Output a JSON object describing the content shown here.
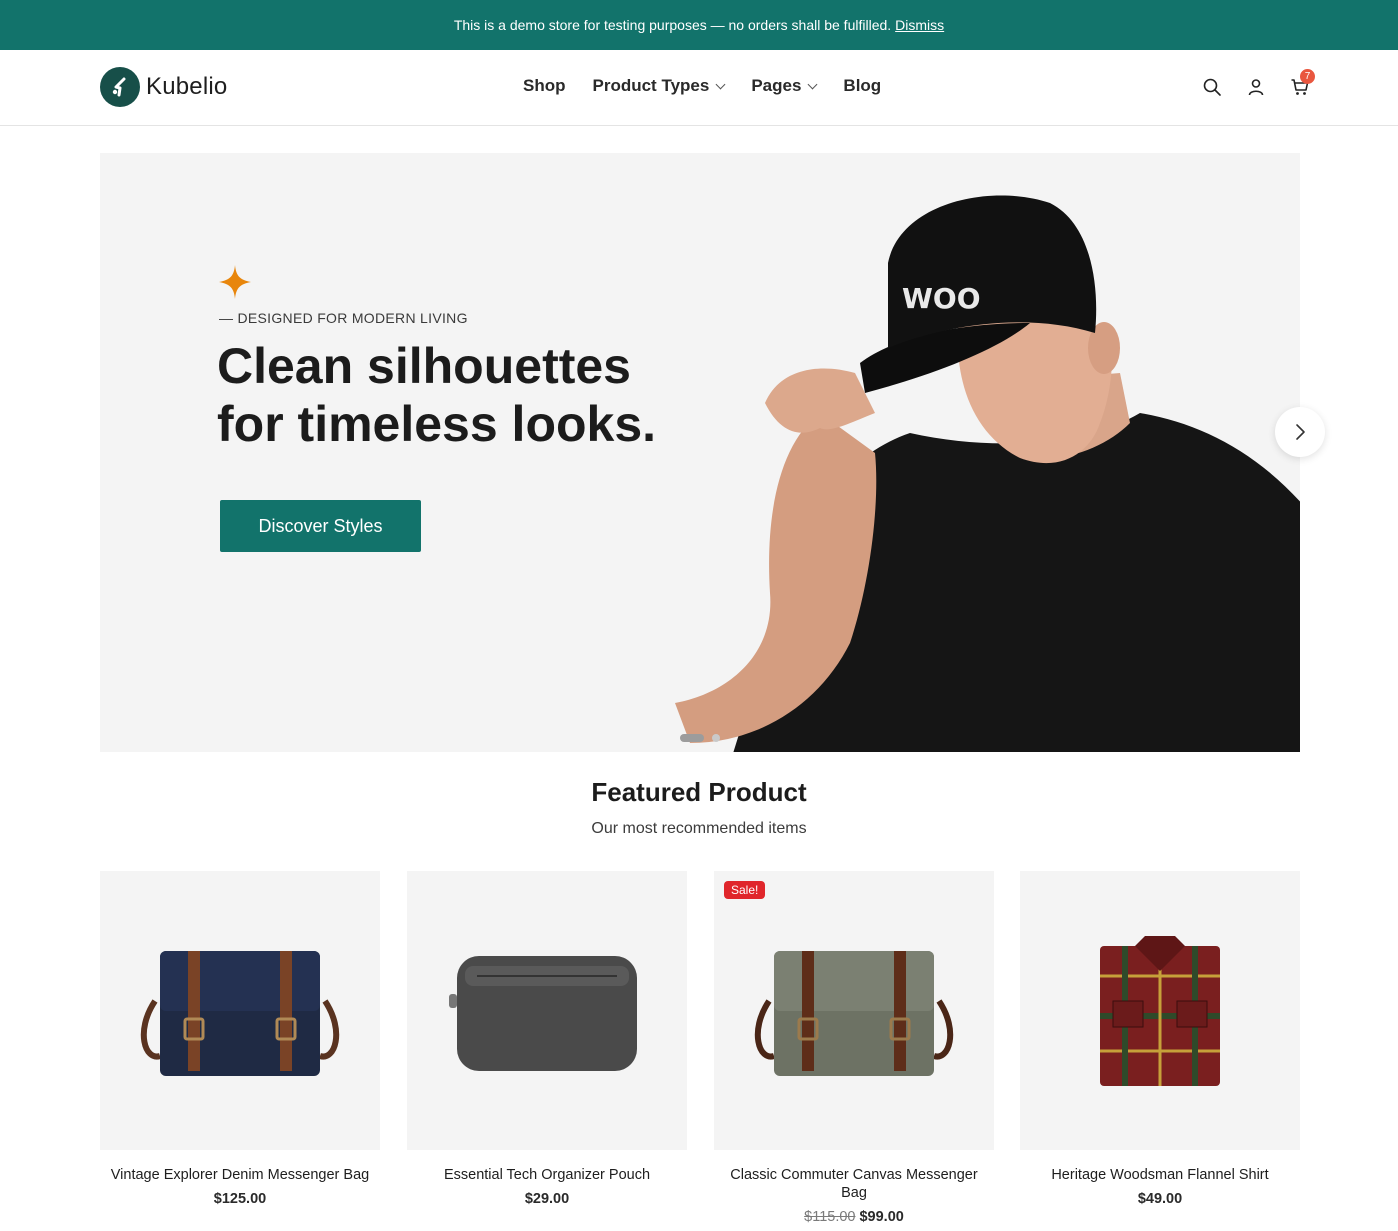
{
  "notice": {
    "text": "This is a demo store for testing purposes — no orders shall be fulfilled.",
    "dismiss": "Dismiss"
  },
  "header": {
    "brand": "Kubelio",
    "nav": [
      {
        "label": "Shop"
      },
      {
        "label": "Product Types"
      },
      {
        "label": "Pages"
      },
      {
        "label": "Blog"
      }
    ],
    "cart_count": "7"
  },
  "hero": {
    "eyebrow": "— DESIGNED FOR MODERN LIVING",
    "title_line1": "Clean silhouettes",
    "title_line2": "for timeless looks.",
    "cta": "Discover Styles",
    "cap_text": "WOO"
  },
  "featured": {
    "title": "Featured Product",
    "subtitle": "Our most recommended items",
    "products": [
      {
        "name": "Vintage Explorer Denim Messenger Bag",
        "price": "$125.00",
        "old_price": "",
        "sale": ""
      },
      {
        "name": "Essential Tech Organizer Pouch",
        "price": "$29.00",
        "old_price": "",
        "sale": ""
      },
      {
        "name": "Classic Commuter Canvas Messenger Bag",
        "price": "$99.00",
        "old_price": "$115.00",
        "sale": "Sale!"
      },
      {
        "name": "Heritage Woodsman Flannel Shirt",
        "price": "$49.00",
        "old_price": "",
        "sale": ""
      }
    ]
  },
  "colors": {
    "accent": "#12736b",
    "brand_dark": "#174f49",
    "sale": "#e0262b",
    "cart_badge": "#e9573f",
    "sparkle": "#e8860c"
  },
  "icons": [
    "search-icon",
    "user-icon",
    "cart-icon",
    "chevron-down-icon",
    "chevron-right-icon",
    "sparkle-icon"
  ]
}
